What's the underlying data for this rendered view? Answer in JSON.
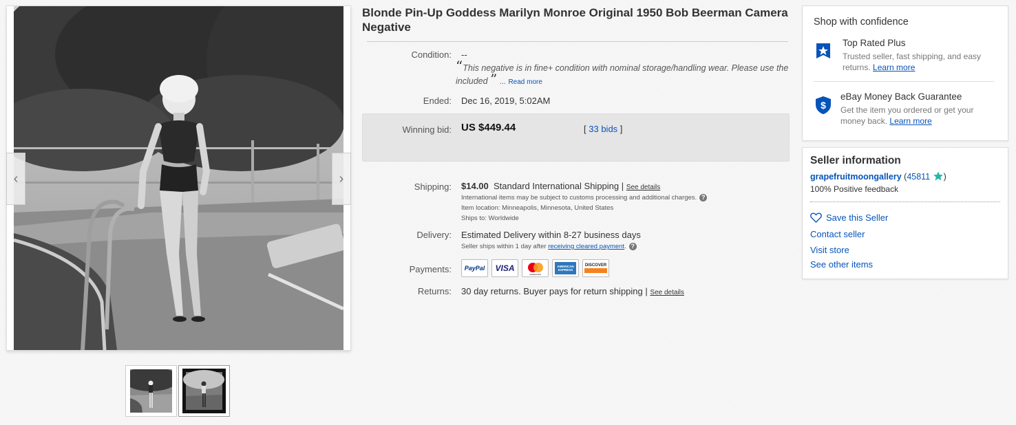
{
  "listing": {
    "title": "Blonde Pin-Up Goddess Marilyn Monroe Original 1950 Bob Beerman Camera Negative",
    "condition_label": "Condition:",
    "condition_value": "--",
    "condition_quote": "This negative is in fine+ condition with nominal storage/handling wear. Please use the included",
    "condition_quote_open": "“",
    "condition_quote_close": "”",
    "ellipsis": "...",
    "read_more": "Read more",
    "ended_label": "Ended:",
    "ended_value": "Dec 16, 2019, 5:02AM",
    "winning_bid_label": "Winning bid:",
    "winning_bid_value": "US $449.44",
    "bids_open": "[",
    "bids_text": "33 bids",
    "bids_close": "]",
    "shipping_label": "Shipping:",
    "shipping_cost": "$14.00",
    "shipping_method": "Standard International Shipping",
    "shipping_sep": "|",
    "see_details": "See details",
    "intl_note": "International items may be subject to customs processing and additional charges.",
    "item_location": "Item location:  Minneapolis, Minnesota, United States",
    "ships_to": "Ships to:  Worldwide",
    "delivery_label": "Delivery:",
    "delivery_value": "Estimated Delivery within 8-27 business days",
    "seller_ships_prefix": "Seller ships within 1 day after",
    "seller_ships_link": "receiving cleared payment",
    "seller_ships_suffix": ".",
    "help_glyph": "?",
    "payments_label": "Payments:",
    "payment_logos": [
      "PayPal",
      "VISA",
      "mastercard",
      "AMERICAN EXPRESS",
      "DISCOVER"
    ],
    "returns_label": "Returns:",
    "returns_value": "30 day returns. Buyer pays for return shipping",
    "returns_sep": "|",
    "returns_see_details": "See details"
  },
  "gallery": {
    "prev_glyph": "‹",
    "next_glyph": "›",
    "thumbnail_count": 2
  },
  "confidence": {
    "heading": "Shop with confidence",
    "top_rated_title": "Top Rated Plus",
    "top_rated_desc": "Trusted seller, fast shipping, and easy returns.",
    "top_rated_link": "Learn more",
    "mbg_title": "eBay Money Back Guarantee",
    "mbg_desc": "Get the item you ordered or get your money back.",
    "mbg_link": "Learn more"
  },
  "seller": {
    "heading": "Seller information",
    "name": "grapefruitmoongallery",
    "score_open": "(",
    "score": "45811",
    "score_close": ")",
    "feedback": "100% Positive feedback",
    "save_seller": "Save this Seller",
    "contact": "Contact seller",
    "visit_store": "Visit store",
    "other_items": "See other items"
  },
  "colors": {
    "link": "#0654ba",
    "ebay_blue": "#0654ba",
    "bid_box": "#e5e5e5",
    "star_teal": "#25b7a7"
  }
}
